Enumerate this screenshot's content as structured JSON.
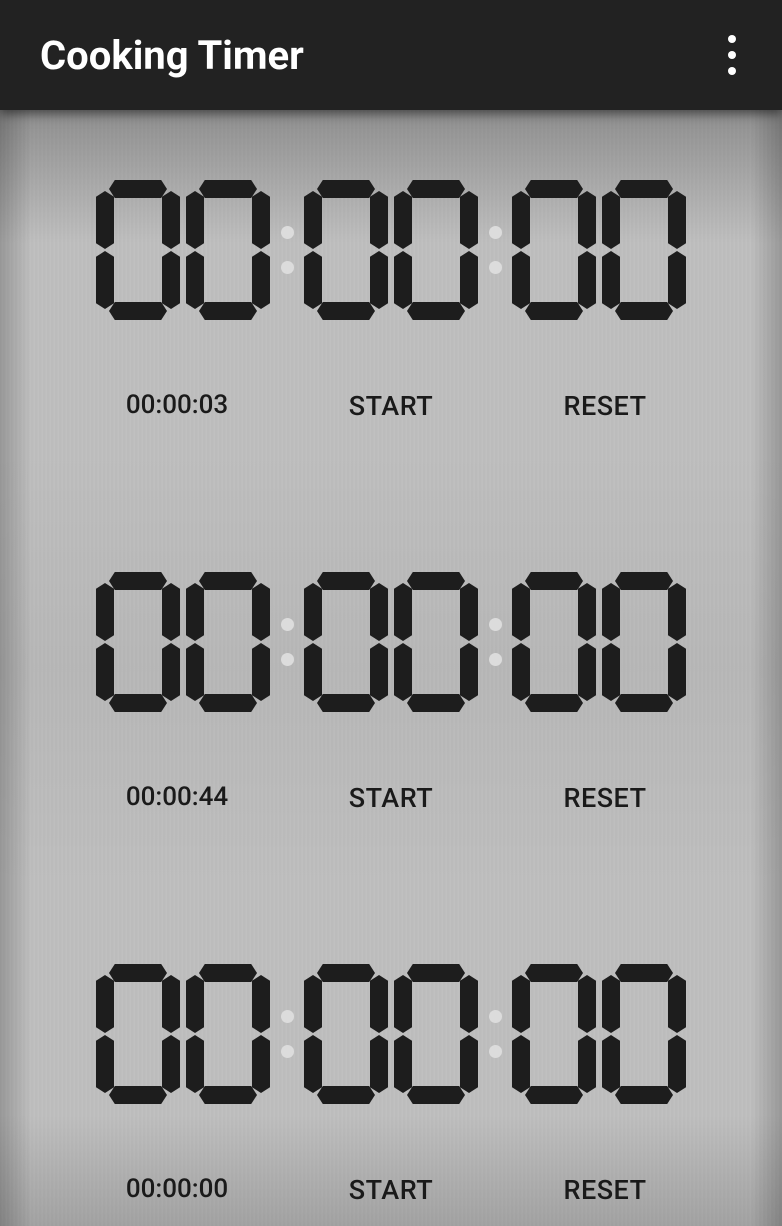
{
  "header": {
    "title": "Cooking Timer"
  },
  "timers": [
    {
      "display": "00:00:00",
      "preset": "00:00:03",
      "start_label": "START",
      "reset_label": "RESET"
    },
    {
      "display": "00:00:00",
      "preset": "00:00:44",
      "start_label": "START",
      "reset_label": "RESET"
    },
    {
      "display": "00:00:00",
      "preset": "00:00:00",
      "start_label": "START",
      "reset_label": "RESET"
    }
  ]
}
